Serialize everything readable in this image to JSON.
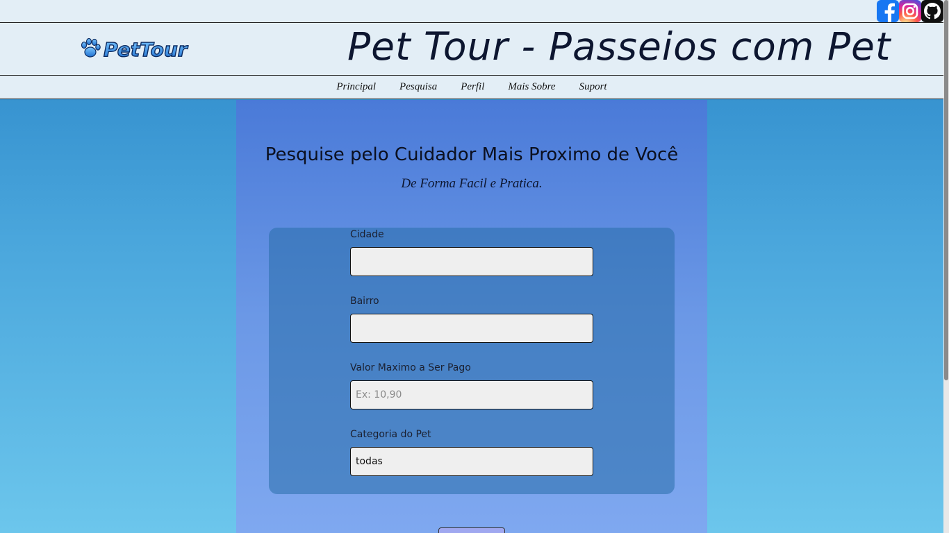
{
  "social": {
    "facebook_icon": "facebook-icon",
    "instagram_icon": "instagram-icon",
    "github_icon": "github-icon"
  },
  "header": {
    "logo_text": "PetTour",
    "title": "Pet Tour - Passeios com Pet"
  },
  "nav": {
    "items": [
      "Principal",
      "Pesquisa",
      "Perfil",
      "Mais Sobre",
      "Suport"
    ]
  },
  "main": {
    "heading": "Pesquise pelo Cuidador Mais Proximo de Você",
    "subheading": "De Forma Facil e Pratica."
  },
  "form": {
    "cidade_label": "Cidade",
    "cidade_value": "",
    "bairro_label": "Bairro",
    "bairro_value": "",
    "valor_label": "Valor Maximo a Ser Pago",
    "valor_placeholder": "Ex: 10,90",
    "categoria_label": "Categoria do Pet",
    "categoria_value": "todas"
  },
  "colors": {
    "header_bg": "#e3eef6",
    "panel_top": "#4a7ad8",
    "panel_bottom": "#7fa8f0",
    "page_top": "#2a86c8",
    "page_bottom": "#6cc6ec"
  }
}
